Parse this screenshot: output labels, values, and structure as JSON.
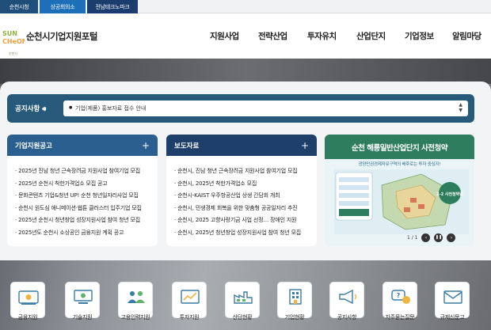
{
  "top_tabs": [
    "순천시청",
    "상공회의소",
    "전남테크노파크"
  ],
  "logo": {
    "title": "순천시기업지원포털",
    "sub": "순천시"
  },
  "nav": [
    "지원사업",
    "전략산업",
    "투자유치",
    "산업단지",
    "기업정보",
    "알림마당"
  ],
  "notice": {
    "label": "공지사항",
    "text": "기업(제품) 홍보자료 접수 안내"
  },
  "panels": [
    {
      "title": "기업지원공고",
      "items": [
        "2025년 진남 청년 근속장려금 지원사업 참여기업 모집",
        "2025년 순천시 착한가격업소 모집 공고",
        "문화콘텐츠 기업&청년 UP! 순천 청년일자리사업 모집",
        "순천시 원도심 애니메이션·웹툰 클러스터 입주기업 모집",
        "2025년 순천시 청년창업 성장지원사업 참여 청년 모집",
        "2025년도 순천시 소상공인 금융지원 계획 공고"
      ]
    },
    {
      "title": "보도자료",
      "items": [
        "순천시, 진남 청년 근속장려금 지원사업 참여기업 모집",
        "순천시, 2025년 착한가격업소 모집",
        "순천시-KAIST 우주항공산업 상생 간담회 개최",
        "순천시, 민생경제 회복을 위한 맞춤형 공공일자리 추진",
        "순천시, 2025 고향사랑기금 사업 선정… 장애인 지원",
        "순천시, 2025년 청년창업 성장지원사업 참여 청년 모집"
      ]
    }
  ],
  "banner": {
    "title": "순천 해룡일반산업단지 사전청약",
    "sub": "광양만권경제자유구역의 배후로는 투자 중심지!",
    "badge": "2-2 사전청약중",
    "page": "1 / 1"
  },
  "quick_links": [
    "금융지원",
    "기술지원",
    "고용인력지원",
    "투자지원",
    "산단현황",
    "기업현황",
    "공지사항",
    "자주묻는질문",
    "규제신문고"
  ],
  "colors": {
    "accent": "#2a5f8f",
    "notice": "#275a7a",
    "banner": "#2e7d5e"
  }
}
